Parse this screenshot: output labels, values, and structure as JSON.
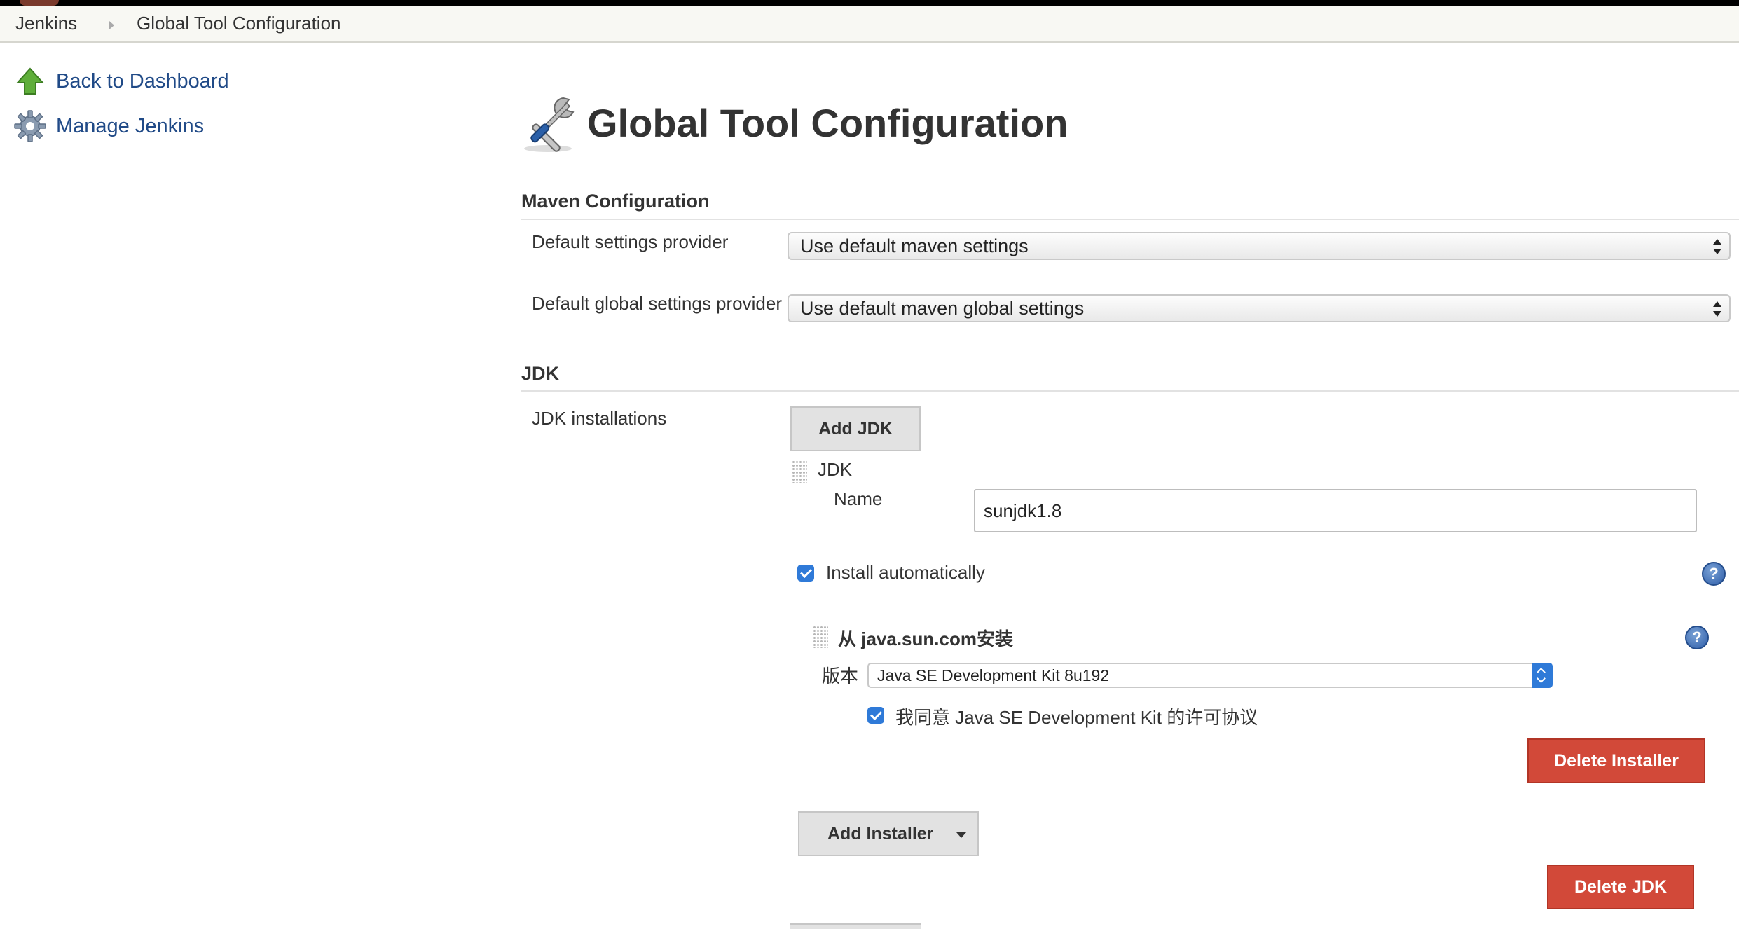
{
  "breadcrumbs": [
    "Jenkins",
    "Global Tool Configuration"
  ],
  "sidebar": {
    "items": [
      {
        "label": "Back to Dashboard",
        "icon": "up-arrow-icon"
      },
      {
        "label": "Manage Jenkins",
        "icon": "gear-icon"
      }
    ]
  },
  "page": {
    "title": "Global Tool Configuration",
    "icon": "tools-icon"
  },
  "maven": {
    "header": "Maven Configuration",
    "settings_label": "Default settings provider",
    "settings_value": "Use default maven settings",
    "global_label": "Default global settings provider",
    "global_value": "Use default maven global settings"
  },
  "jdk": {
    "header": "JDK",
    "installations_label": "JDK installations",
    "add_button": "Add JDK",
    "item_title": "JDK",
    "name_label": "Name",
    "name_value": "sunjdk1.8",
    "install_auto_label": "Install automatically",
    "install_auto_checked": true,
    "installer_title": "从 java.sun.com安装",
    "version_label": "版本",
    "version_value": "Java SE Development Kit 8u192",
    "agree_label": "我同意 Java SE Development Kit 的许可协议",
    "agree_checked": true,
    "delete_installer": "Delete Installer",
    "add_installer": "Add Installer",
    "delete_jdk": "Delete JDK"
  },
  "colors": {
    "link": "#204a87",
    "danger": "#d24939",
    "accent": "#2f7ad8"
  }
}
